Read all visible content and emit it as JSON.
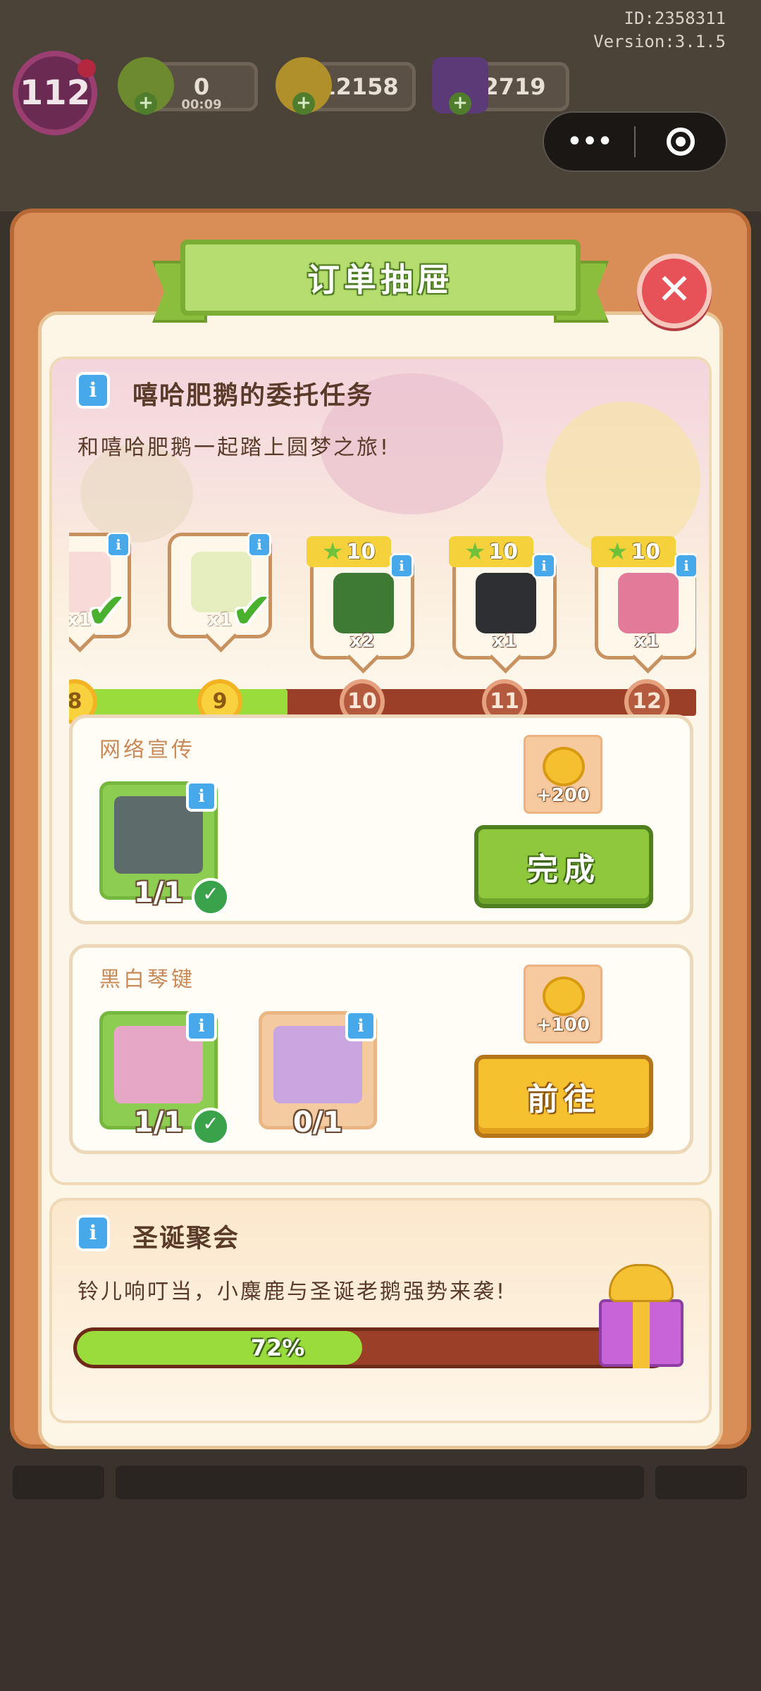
{
  "hud": {
    "id_text": "ID:2358311",
    "version_text": "Version:3.1.5",
    "level": "112",
    "energy": "0",
    "energy_timer": "00:09",
    "coins": "12158",
    "gems": "2719"
  },
  "dialog": {
    "title": "订单抽屉",
    "close_label": "✕"
  },
  "event1": {
    "title": "嘻哈肥鹅的委托任务",
    "subtitle": "和嘻哈肥鹅一起踏上圆梦之旅!",
    "track": {
      "nodes": [
        "8",
        "9",
        "10",
        "11",
        "12"
      ],
      "cards": [
        {
          "qty": "x1",
          "done": true
        },
        {
          "qty": "x1",
          "done": true
        },
        {
          "qty": "x2",
          "star": "10"
        },
        {
          "qty": "x1",
          "star": "10"
        },
        {
          "qty": "x1",
          "star": "10"
        }
      ]
    },
    "tasks": [
      {
        "name": "网络宣传",
        "items": [
          {
            "progress": "1/1"
          }
        ],
        "reward": "+200",
        "button": "完成"
      },
      {
        "name": "黑白琴键",
        "items": [
          {
            "progress": "1/1"
          },
          {
            "progress": "0/1"
          }
        ],
        "reward": "+100",
        "button": "前往"
      }
    ]
  },
  "event2": {
    "title": "圣诞聚会",
    "subtitle": "铃儿响叮当，小麋鹿与圣诞老鹅强势来袭!",
    "progress_text": "72%",
    "progress_value": 0.72
  },
  "colors": {
    "accent_green": "#8fc83c",
    "accent_yellow": "#f6c12f",
    "panel_orange": "#d98e57",
    "info_blue": "#47a8ea"
  }
}
